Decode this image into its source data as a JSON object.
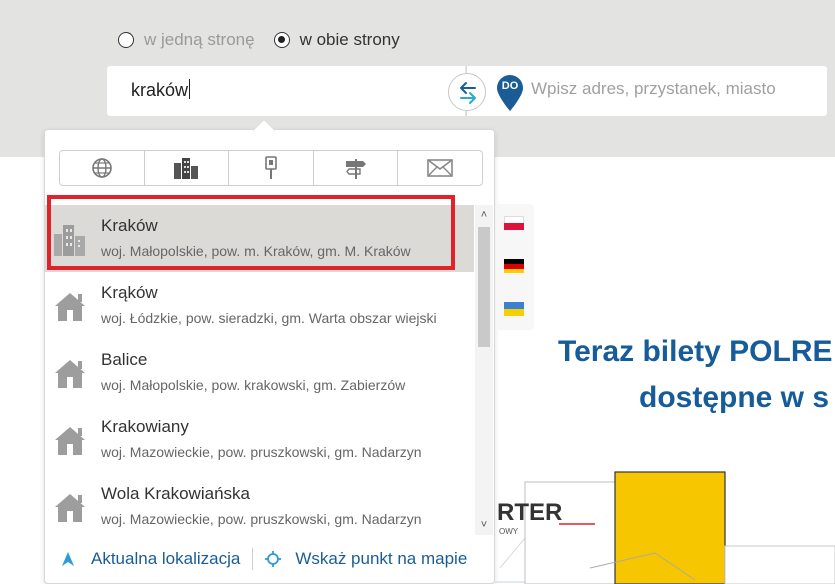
{
  "trip_type": {
    "one_way_label": "w jedną stronę",
    "both_ways_label": "w obie strony",
    "selected": "w obie strony"
  },
  "from": {
    "value": "kraków"
  },
  "to": {
    "badge": "DO",
    "placeholder": "Wpisz adres, przystanek, miasto"
  },
  "filter_tabs": [
    "globe-icon",
    "city-icon",
    "stop-icon",
    "signpost-icon",
    "envelope-icon"
  ],
  "results": [
    {
      "name": "Kraków",
      "desc": "woj. Małopolskie, pow. m. Kraków, gm. M. Kraków",
      "icon": "city-icon",
      "selected": true
    },
    {
      "name": "Krąków",
      "desc": "woj. Łódzkie, pow. sieradzki, gm. Warta obszar wiejski",
      "icon": "house-icon"
    },
    {
      "name": "Balice",
      "desc": "woj. Małopolskie, pow. krakowski, gm. Zabierzów",
      "icon": "house-icon"
    },
    {
      "name": "Krakowiany",
      "desc": "woj. Mazowieckie, pow. pruszkowski, gm. Nadarzyn",
      "icon": "house-icon"
    },
    {
      "name": "Wola Krakowiańska",
      "desc": "woj. Mazowieckie, pow. pruszkowski, gm. Nadarzyn",
      "icon": "house-icon"
    }
  ],
  "bottom_actions": {
    "location": "Aktualna lokalizacja",
    "map_point": "Wskaż punkt na mapie"
  },
  "languages": [
    "pl",
    "de",
    "ua"
  ],
  "promo": {
    "line1": "Teraz bilety POLRE",
    "line2": "dostępne w s"
  },
  "illustration": {
    "text": "RTER",
    "subtext": "OWY"
  },
  "colors": {
    "accent": "#1a5d96",
    "highlight": "#e0222a",
    "band": "#e3e3e1",
    "promo": "#165b9a",
    "yellow": "#f6c600"
  }
}
